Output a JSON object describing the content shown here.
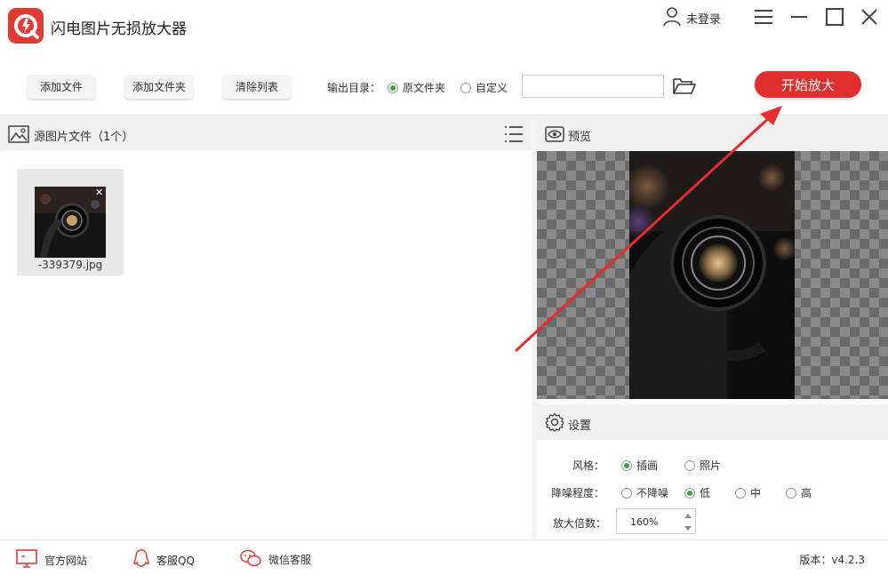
{
  "app": {
    "title": "闪电图片无损放大器",
    "brand_color": "#e23b33",
    "login_label": "未登录"
  },
  "toolbar": {
    "add_file": "添加文件",
    "add_folder": "添加文件夹",
    "clear_list": "清除列表",
    "output_label": "输出目录：",
    "output_options": [
      {
        "label": "原文件夹",
        "selected": true
      },
      {
        "label": "自定义",
        "selected": false
      }
    ],
    "path_value": "",
    "start_label": "开始放大",
    "start_color": "#e02e2e"
  },
  "source": {
    "title": "源图片文件（1个）",
    "files": [
      {
        "name": "-339379.jpg"
      }
    ]
  },
  "preview": {
    "title": "预览"
  },
  "settings": {
    "title": "设置",
    "style_label": "风格：",
    "style_options": [
      {
        "label": "插画",
        "selected": true
      },
      {
        "label": "照片",
        "selected": false
      }
    ],
    "denoise_label": "降噪程度：",
    "denoise_options": [
      {
        "label": "不降噪",
        "selected": false
      },
      {
        "label": "低",
        "selected": true
      },
      {
        "label": "中",
        "selected": false
      },
      {
        "label": "高",
        "selected": false
      }
    ],
    "scale_label": "放大倍数：",
    "scale_value": "160%"
  },
  "statusbar": {
    "website": "官方网站",
    "qq": "客服QQ",
    "wechat": "微信客服",
    "version": "版本：v4.2.3"
  },
  "icons": [
    "app-logo-icon",
    "user-icon",
    "menu-icon",
    "minimize-icon",
    "maximize-icon",
    "close-icon",
    "folder-open-icon",
    "image-icon",
    "list-icon",
    "eye-icon",
    "gear-icon",
    "monitor-icon",
    "qq-icon",
    "wechat-icon"
  ]
}
